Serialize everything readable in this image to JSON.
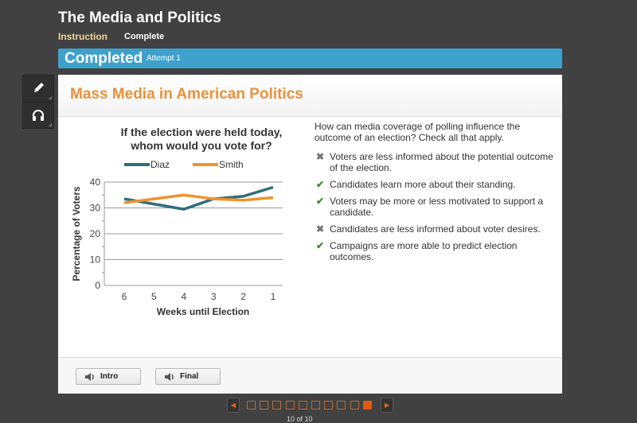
{
  "app": {
    "title": "The Media and Politics",
    "tabs": [
      {
        "label": "Instruction",
        "active": true
      },
      {
        "label": "Complete",
        "active": false
      }
    ]
  },
  "status": {
    "label": "Completed",
    "attempt": "Attempt 1",
    "color": "#3ea1cc"
  },
  "tools": [
    {
      "name": "pencil-icon"
    },
    {
      "name": "headphones-icon"
    }
  ],
  "panel": {
    "title": "Mass Media in American Politics",
    "title_color": "#e9913a"
  },
  "chart_data": {
    "type": "line",
    "title": "If the election were held today, whom would you vote for?",
    "title_lines": [
      "If the election were held today,",
      "whom would you vote for?"
    ],
    "xlabel": "Weeks until Election",
    "ylabel": "Percentage of Voters",
    "x": [
      "6",
      "5",
      "4",
      "3",
      "2",
      "1"
    ],
    "ylim": [
      0,
      40
    ],
    "yticks": [
      0,
      10,
      20,
      30,
      40
    ],
    "grid": true,
    "legend_position": "top",
    "series": [
      {
        "name": "Diaz",
        "color": "#2f6e7a",
        "values": [
          33.5,
          31.5,
          29.5,
          33.5,
          34.5,
          38
        ]
      },
      {
        "name": "Smith",
        "color": "#f0932e",
        "values": [
          32,
          33.5,
          35,
          33.5,
          33,
          34
        ]
      }
    ]
  },
  "question": {
    "prompt": "How can media coverage of polling influence the outcome of an election? Check all that apply.",
    "answers": [
      {
        "text": "Voters are less informed about the potential outcome of the election.",
        "result": "incorrect",
        "icon": "x-mark-icon",
        "glyph": "✖"
      },
      {
        "text": "Candidates learn more about their standing.",
        "result": "correct",
        "icon": "check-icon",
        "glyph": "✔"
      },
      {
        "text": "Voters may be more or less motivated to support a candidate.",
        "result": "correct",
        "icon": "check-icon",
        "glyph": "✔"
      },
      {
        "text": "Candidates are less informed about voter desires.",
        "result": "incorrect",
        "icon": "x-mark-icon",
        "glyph": "✖"
      },
      {
        "text": "Campaigns are more able to predict election outcomes.",
        "result": "correct",
        "icon": "check-icon",
        "glyph": "✔"
      }
    ]
  },
  "footer": {
    "buttons": [
      {
        "label": "Intro",
        "icon": "speaker-icon"
      },
      {
        "label": "Final",
        "icon": "speaker-icon"
      }
    ]
  },
  "pager": {
    "total": 10,
    "current": 10,
    "prev_glyph": "◀",
    "next_glyph": "▶",
    "counter": "10 of 10",
    "accent": "#e25a12"
  }
}
